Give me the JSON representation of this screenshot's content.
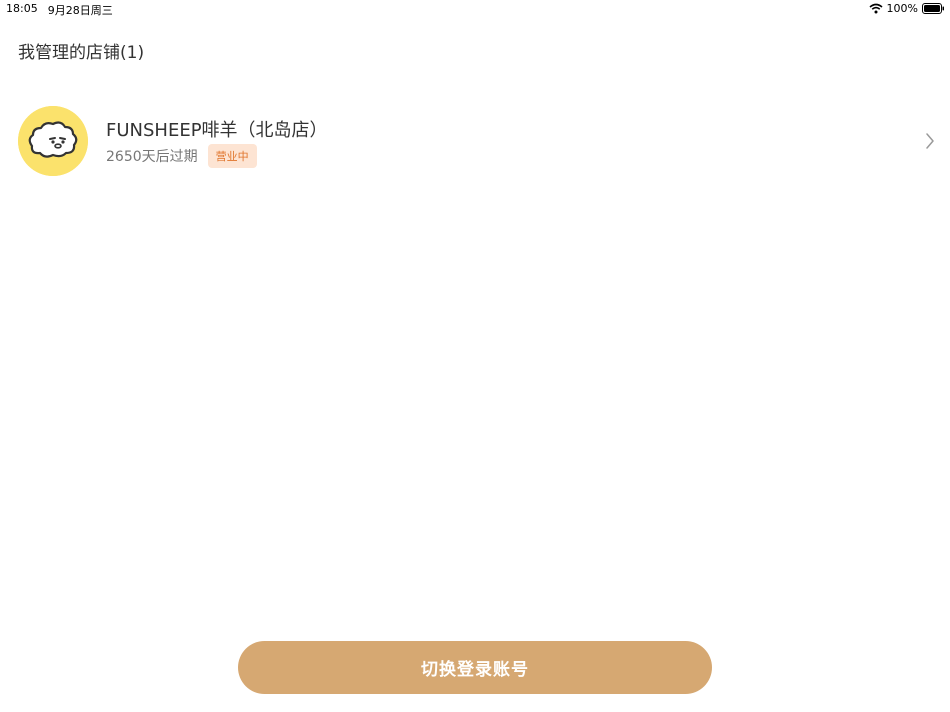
{
  "status_bar": {
    "time": "18:05",
    "date": "9月28日周三",
    "battery": "100%",
    "icons": [
      "wifi-icon",
      "battery-icon"
    ]
  },
  "header": {
    "title": "我管理的店铺(1)"
  },
  "stores": [
    {
      "name": "FUNSHEEP啡羊（北岛店）",
      "expiry": "2650天后过期",
      "status": "营业中",
      "avatar_icon": "sheep-logo-icon"
    }
  ],
  "footer": {
    "switch_account_label": "切换登录账号"
  },
  "colors": {
    "accent": "#d6a872",
    "avatar_bg": "#fbe26c",
    "badge_text": "#e0752c",
    "badge_bg": "#fde4d3"
  }
}
